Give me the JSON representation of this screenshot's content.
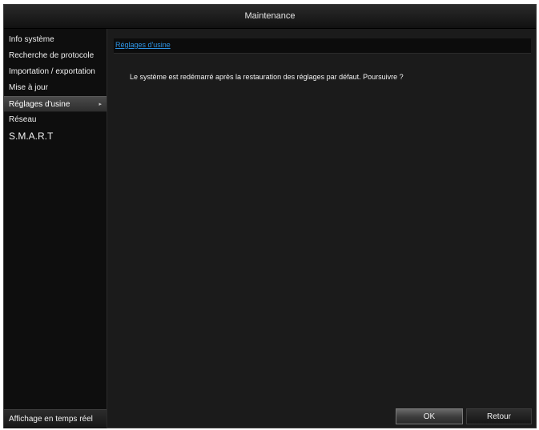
{
  "window": {
    "title": "Maintenance"
  },
  "sidebar": {
    "items": [
      {
        "label": "Info système"
      },
      {
        "label": "Recherche de protocole"
      },
      {
        "label": "Importation / exportation"
      },
      {
        "label": "Mise à jour"
      },
      {
        "label": "Réglages d'usine",
        "arrow": "▸"
      },
      {
        "label": "Réseau"
      },
      {
        "label": "S.M.A.R.T"
      }
    ],
    "liveview_label": "Affichage en temps réel"
  },
  "content": {
    "tab_label": "Réglages d'usine",
    "message": "Le système est redémarré après la restauration des réglages par défaut. Poursuivre ?"
  },
  "buttons": {
    "ok_label": "OK",
    "back_label": "Retour"
  }
}
